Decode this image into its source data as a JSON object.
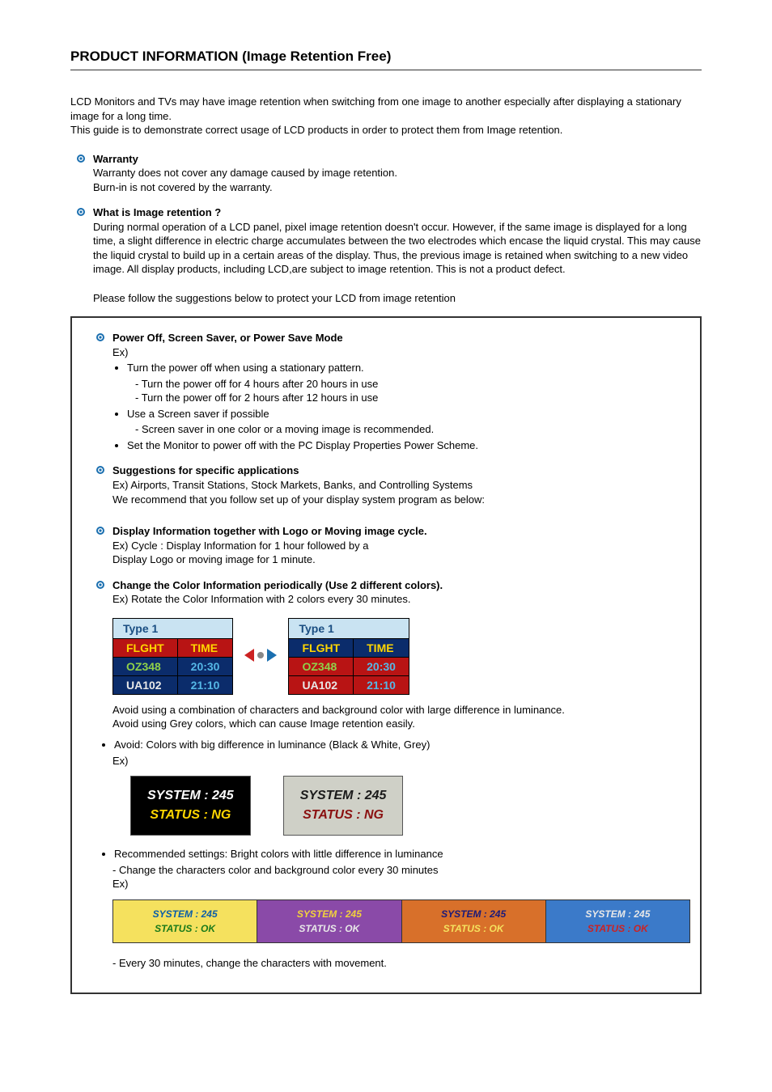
{
  "title": "PRODUCT INFORMATION (Image Retention Free)",
  "intro1": "LCD Monitors and TVs may have image retention when switching from one image to another especially after displaying a stationary image for a long time.",
  "intro2": "This guide is to demonstrate correct usage of LCD products in order to protect them from Image retention.",
  "warranty": {
    "h": "Warranty",
    "l1": "Warranty does not cover any damage caused by image retention.",
    "l2": "Burn-in is not covered by the warranty."
  },
  "what": {
    "h": "What is Image retention ?",
    "p1": "During normal operation of a LCD panel, pixel image retention doesn't occur. However, if the same image is displayed for a long time, a slight difference in electric charge accumulates between the two electrodes which encase the liquid crystal. This may cause the liquid crystal to build up in a certain areas of the display. Thus, the previous image is retained when switching to a new video image. All display products, including LCD,are subject to image retention. This is not a product defect.",
    "p2": "Please follow the suggestions below to protect your LCD from image retention"
  },
  "power": {
    "h": "Power Off, Screen Saver, or Power Save Mode",
    "ex": "Ex)",
    "b1": "Turn the power off when using a stationary pattern.",
    "b1a": "- Turn the power off for 4 hours after 20 hours in use",
    "b1b": "- Turn the power off for 2 hours after 12 hours in use",
    "b2": "Use a Screen saver if possible",
    "b2a": "- Screen saver in one color or a moving image is recommended.",
    "b3": "Set the Monitor to power off with the PC Display Properties Power Scheme."
  },
  "sugg": {
    "h": "Suggestions for specific applications",
    "l1": "Ex) Airports, Transit Stations, Stock Markets, Banks, and Controlling Systems",
    "l2": "We recommend that you follow set up of your display system program as below:"
  },
  "disp": {
    "h": "Display Information together with Logo or Moving image cycle.",
    "l1": "Ex) Cycle : Display Information for 1 hour followed by a",
    "l2": "Display Logo or moving image for 1 minute."
  },
  "change": {
    "h": "Change the Color Information periodically (Use 2 different colors).",
    "l1": "Ex) Rotate the Color Information with 2 colors every 30 minutes."
  },
  "tbl": {
    "type": "Type 1",
    "h1": "FLGHT",
    "h2": "TIME",
    "r1c1": "OZ348",
    "r1c2": "20:30",
    "r2c1": "UA102",
    "r2c2": "21:10"
  },
  "avoid": {
    "l1": "Avoid using a combination of characters and background color with large difference in luminance.",
    "l2": "Avoid using Grey colors, which can cause Image retention easily.",
    "b1": "Avoid: Colors with big difference in luminance (Black & White, Grey)",
    "ex": "Ex)"
  },
  "sys": {
    "l1": "SYSTEM : 245",
    "l2": "STATUS : NG"
  },
  "rec": {
    "b1": "Recommended settings: Bright colors with little difference in luminance",
    "l1": "- Change the characters color and background color every 30 minutes",
    "ex": "Ex)"
  },
  "cbox": {
    "l1": "SYSTEM : 245",
    "l2": "STATUS : OK"
  },
  "last": "- Every 30 minutes, change the characters with movement."
}
